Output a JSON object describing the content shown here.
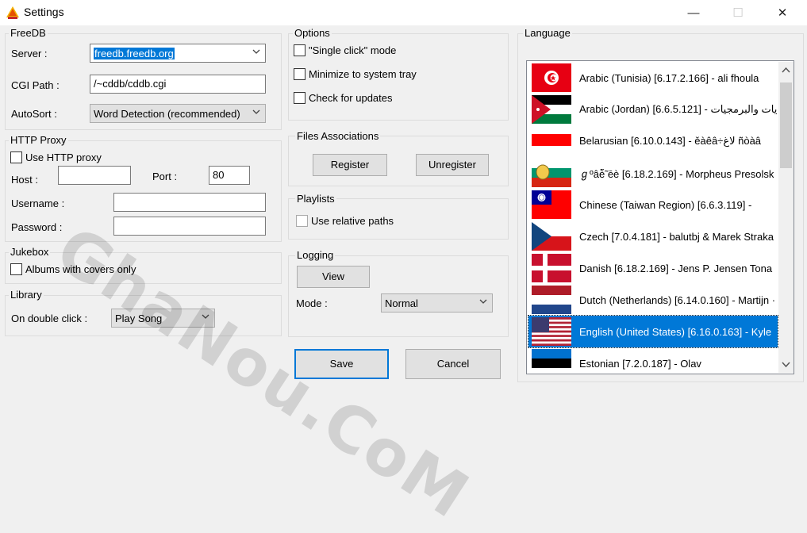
{
  "window": {
    "title": "Settings",
    "minimize_glyph": "—",
    "maximize_glyph": "☐",
    "close_glyph": "✕"
  },
  "freedb": {
    "title": "FreeDB",
    "server_label": "Server :",
    "server_value": "freedb.freedb.org",
    "cgi_label": "CGI Path :",
    "cgi_value": "/~cddb/cddb.cgi",
    "autosort_label": "AutoSort :",
    "autosort_value": "Word Detection (recommended)"
  },
  "http_proxy": {
    "title": "HTTP Proxy",
    "use_proxy_label": "Use HTTP proxy",
    "host_label": "Host :",
    "host_value": "",
    "port_label": "Port :",
    "port_value": "80",
    "username_label": "Username :",
    "username_value": "",
    "password_label": "Password :",
    "password_value": ""
  },
  "jukebox": {
    "title": "Jukebox",
    "albums_covers_label": "Albums with covers only"
  },
  "library": {
    "title": "Library",
    "double_click_label": "On double click :",
    "double_click_value": "Play Song"
  },
  "options": {
    "title": "Options",
    "single_click_label": "\"Single click\"  mode",
    "minimize_tray_label": "Minimize to system tray",
    "check_updates_label": "Check for updates"
  },
  "files_assoc": {
    "title": "Files Associations",
    "register_label": "Register",
    "unregister_label": "Unregister"
  },
  "playlists": {
    "title": "Playlists",
    "relative_paths_label": "Use relative paths"
  },
  "logging": {
    "title": "Logging",
    "view_label": "View",
    "mode_label": "Mode :",
    "mode_value": "Normal"
  },
  "actions": {
    "save_label": "Save",
    "cancel_label": "Cancel"
  },
  "language": {
    "title": "Language",
    "selected_index": 8,
    "items": [
      {
        "text": "Arabic (Tunisia) [6.17.2.166] - ali fhoula",
        "flag": "tunisia"
      },
      {
        "text": "Arabic (Jordan) [6.6.5.121] - يات والبرمجيات",
        "flag": "jordan"
      },
      {
        "text": "Belarusian [6.10.0.143] - ěàêâ÷لاغ ñòàâ",
        "flag": "belarus"
      },
      {
        "text": "ℊºâè̃̃ ēè [6.18.2.169] - Morpheus Presolsk",
        "flag": "bulgaria"
      },
      {
        "text": "Chinese (Taiwan Region) [6.6.3.119] -",
        "flag": "taiwan"
      },
      {
        "text": "Czech [7.0.4.181] - balutbj & Marek Straka",
        "flag": "czech"
      },
      {
        "text": "Danish [6.18.2.169] - Jens P. Jensen Tona",
        "flag": "denmark"
      },
      {
        "text": "Dutch (Netherlands) [6.14.0.160] - Martijn ·",
        "flag": "netherlands"
      },
      {
        "text": "English (United States) [6.16.0.163] - Kyle",
        "flag": "usa"
      },
      {
        "text": "Estonian [7.2.0.187] - Olav",
        "flag": "estonia"
      }
    ]
  },
  "watermark": "GhaNou.CoM",
  "colors": {
    "accent": "#0078d7",
    "window_bg": "#f0f0f0"
  }
}
